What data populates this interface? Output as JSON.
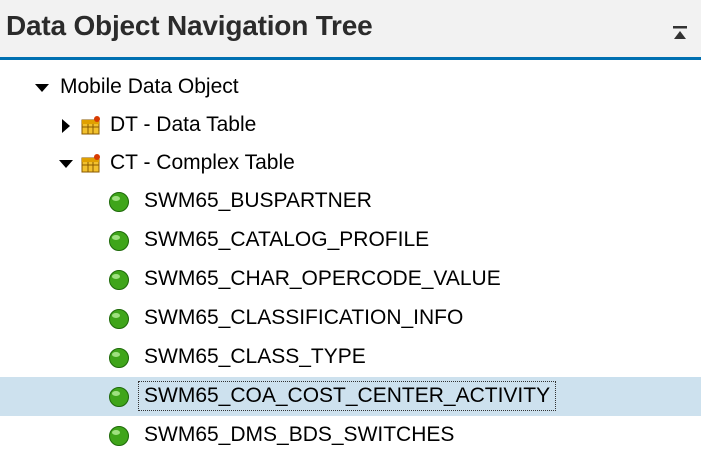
{
  "panel": {
    "title": "Data Object Navigation Tree",
    "collapse_icon": "collapse-up-icon"
  },
  "tree": {
    "root": {
      "label": "Mobile Data Object",
      "expanded": true
    },
    "groups": [
      {
        "label": "DT - Data Table",
        "expanded": false,
        "icon": "table-icon"
      },
      {
        "label": "CT - Complex Table",
        "expanded": true,
        "icon": "table-icon"
      }
    ],
    "items": [
      {
        "label": "SWM65_BUSPARTNER",
        "icon": "green-status-icon",
        "selected": false
      },
      {
        "label": "SWM65_CATALOG_PROFILE",
        "icon": "green-status-icon",
        "selected": false
      },
      {
        "label": "SWM65_CHAR_OPERCODE_VALUE",
        "icon": "green-status-icon",
        "selected": false
      },
      {
        "label": "SWM65_CLASSIFICATION_INFO",
        "icon": "green-status-icon",
        "selected": false
      },
      {
        "label": "SWM65_CLASS_TYPE",
        "icon": "green-status-icon",
        "selected": false
      },
      {
        "label": "SWM65_COA_COST_CENTER_ACTIVITY",
        "icon": "green-status-icon",
        "selected": true
      },
      {
        "label": "SWM65_DMS_BDS_SWITCHES",
        "icon": "green-status-icon",
        "selected": false
      }
    ]
  },
  "colors": {
    "header_bg": "#f2f2f2",
    "header_accent": "#0070b1",
    "selection": "#cde1ee",
    "status_green": "#3fa51a"
  }
}
